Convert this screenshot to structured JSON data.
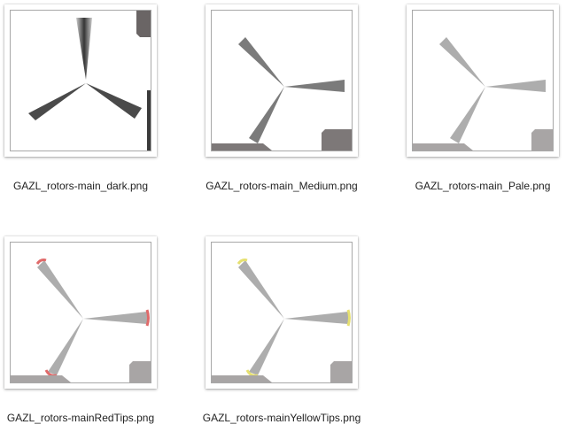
{
  "files": [
    {
      "name": "GAZL_rotors-main_dark.png",
      "variant": "dark",
      "blade_color": "#2a2a2a",
      "tip_color": "",
      "corner_color": "#6a6565",
      "bar_color": "#3a3a3a"
    },
    {
      "name": "GAZL_rotors-main_Medium.png",
      "variant": "medium",
      "blade_color": "#5a5a5a",
      "tip_color": "",
      "corner_color": "#7d7878",
      "bar_color": "#7d7878"
    },
    {
      "name": "GAZL_rotors-main_Pale.png",
      "variant": "pale",
      "blade_color": "#8a8a8a",
      "tip_color": "",
      "corner_color": "#a8a5a5",
      "bar_color": "#a8a5a5"
    },
    {
      "name": "GAZL_rotors-mainRedTips.png",
      "variant": "red-tips",
      "blade_color": "#8a8a8a",
      "tip_color": "#e06a6a",
      "corner_color": "#a8a5a5",
      "bar_color": "#a8a5a5"
    },
    {
      "name": "GAZL_rotors-mainYellowTips.png",
      "variant": "yellow-tips",
      "blade_color": "#8a8a8a",
      "tip_color": "#e6e070",
      "corner_color": "#a8a5a5",
      "bar_color": "#a8a5a5"
    }
  ]
}
